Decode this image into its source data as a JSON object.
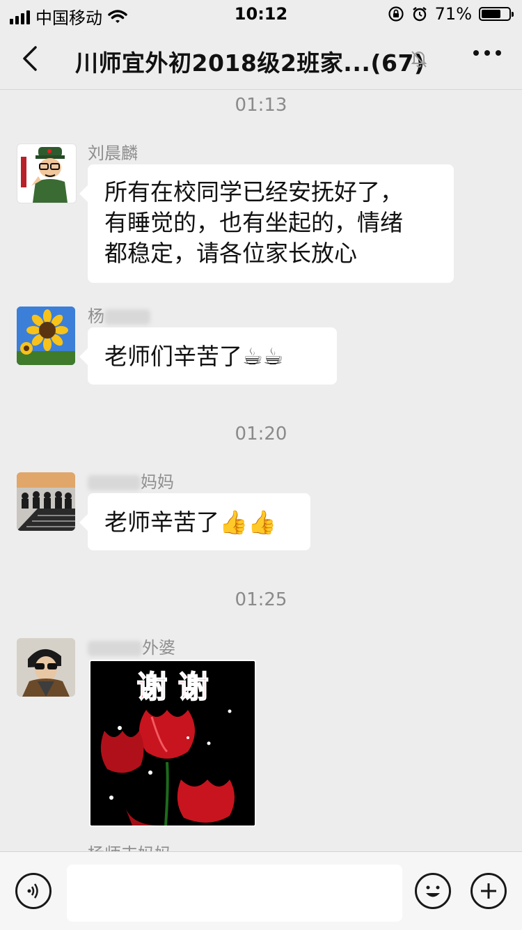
{
  "status_bar": {
    "carrier": "中国移动",
    "time": "10:12",
    "battery_percent": "71%",
    "battery_level": 0.71
  },
  "nav": {
    "title": "川师宜外初2018级2班家...(67)"
  },
  "messages": [
    {
      "type": "timestamp",
      "text": "01:13"
    },
    {
      "type": "text",
      "sender": "刘晨麟",
      "lines": [
        "所有在校同学已经安抚好了，",
        "有睡觉的，也有坐起的，情绪",
        "都稳定，请各位家长放心"
      ]
    },
    {
      "type": "text",
      "sender": "杨",
      "text": "老师们辛苦了☕☕"
    },
    {
      "type": "timestamp",
      "text": "01:20"
    },
    {
      "type": "text",
      "sender_suffix": "妈妈",
      "text": "老师辛苦了👍👍"
    },
    {
      "type": "timestamp",
      "text": "01:25"
    },
    {
      "type": "image",
      "sender_suffix": "外婆",
      "image_text": "谢 谢"
    },
    {
      "type": "partial",
      "sender": "杨师丰妈妈"
    }
  ],
  "colors": {
    "background": "#ededed",
    "bubble": "#ffffff",
    "timestamp": "#8a8a8a",
    "sender": "#8e8e8e",
    "image_text": "#e0141e"
  }
}
